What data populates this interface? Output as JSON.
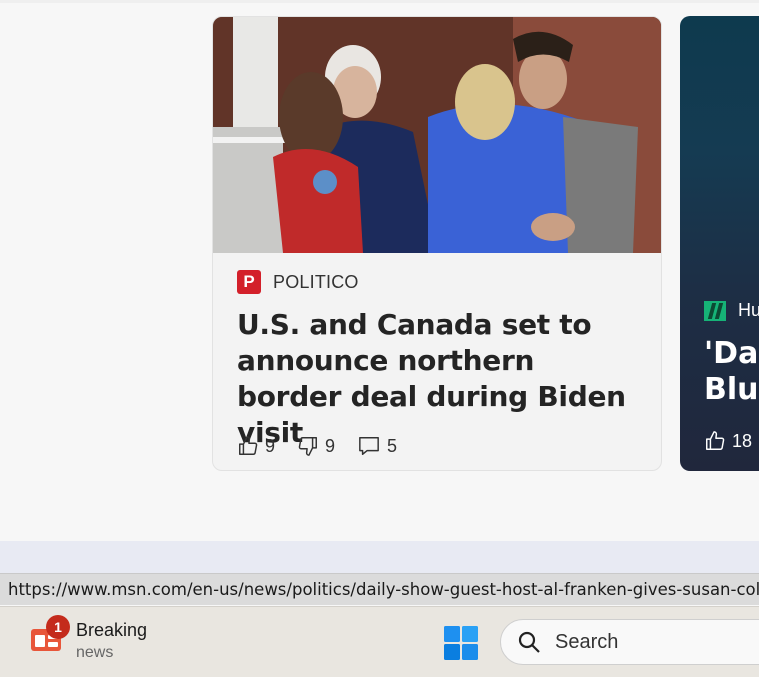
{
  "article": {
    "publisher": "POLITICO",
    "publisher_logo_letter": "P",
    "headline": "U.S. and Canada set to announce northern border deal during Biden visit",
    "likes": "9",
    "dislikes": "9",
    "comments": "5"
  },
  "next_article": {
    "publisher_partial": "Hu",
    "headline_line1": "'Dai",
    "headline_line2": "Blur",
    "likes": "18"
  },
  "status_url": "https://www.msn.com/en-us/news/politics/daily-show-guest-host-al-franken-gives-susan-collins",
  "taskbar": {
    "widget_badge": "1",
    "widget_title": "Breaking",
    "widget_subtitle": "news",
    "search_label": "Search"
  },
  "colors": {
    "politico_red": "#d3202a",
    "huffpost_green": "#16b377",
    "badge_red": "#c42b1c",
    "windows_blue": "#0a7ee0"
  },
  "icons": [
    "thumbs-up-icon",
    "thumbs-down-icon",
    "comment-icon",
    "politico-logo-icon",
    "huffpost-logo-icon",
    "widgets-icon",
    "windows-start-icon",
    "search-icon"
  ]
}
